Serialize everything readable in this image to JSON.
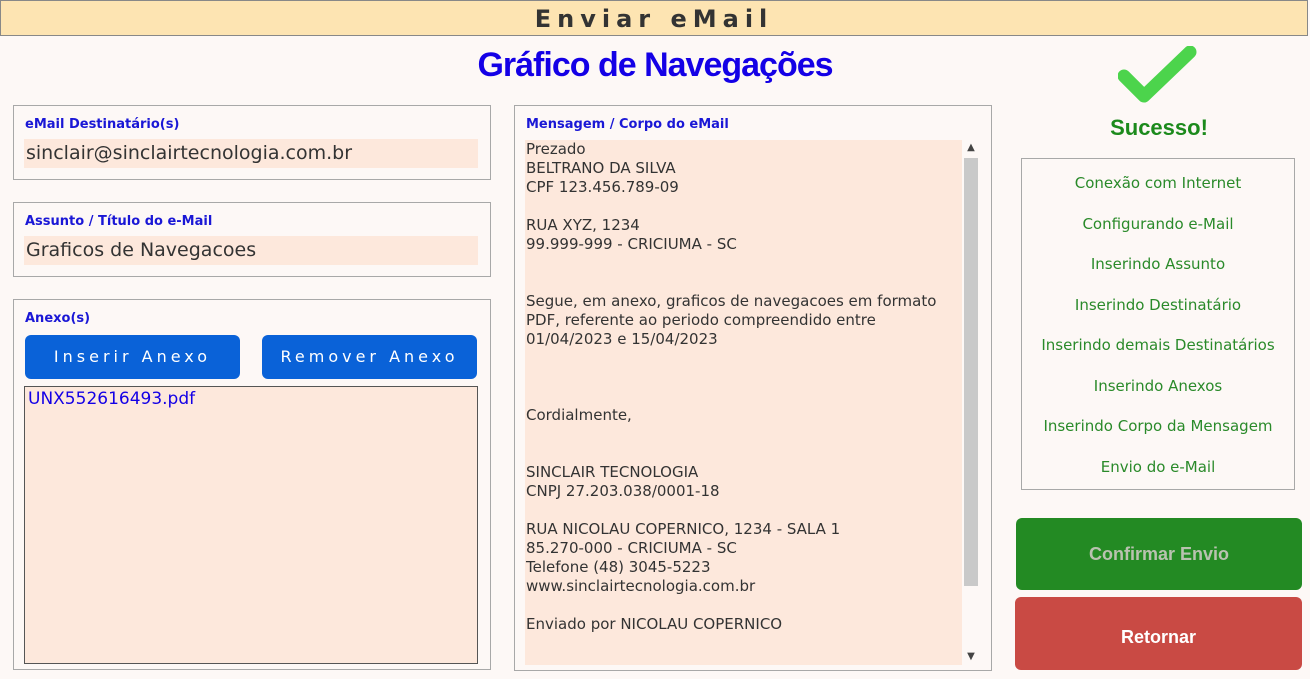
{
  "window": {
    "title": "Enviar eMail"
  },
  "header": {
    "title": "Gráfico de Navegações"
  },
  "recipients": {
    "label": "eMail Destinatário(s)",
    "value": "sinclair@sinclairtecnologia.com.br"
  },
  "subject": {
    "label": "Assunto / Título do e-Mail",
    "value": "Graficos de Navegacoes"
  },
  "attachments": {
    "label": "Anexo(s)",
    "add_label": "Inserir Anexo",
    "remove_label": "Remover Anexo",
    "files": [
      "UNX552616493.pdf"
    ]
  },
  "message": {
    "label": "Mensagem / Corpo do eMail",
    "body": "Prezado\nBELTRANO DA SILVA\nCPF 123.456.789-09\n\nRUA XYZ, 1234\n99.999-999 - CRICIUMA - SC\n\n\nSegue, em anexo, graficos de navegacoes em formato\nPDF, referente ao periodo compreendido entre\n01/04/2023 e 15/04/2023\n\n\n\nCordialmente,\n\n\nSINCLAIR TECNOLOGIA\nCNPJ 27.203.038/0001-18\n\nRUA NICOLAU COPERNICO, 1234 - SALA 1\n85.270-000 - CRICIUMA - SC\nTelefone (48) 3045-5223\nwww.sinclairtecnologia.com.br\n\nEnviado por NICOLAU COPERNICO"
  },
  "status": {
    "text": "Sucesso!",
    "icon": "check-icon",
    "color": "#4cd44c",
    "steps": [
      "Conexão com Internet",
      "Configurando e-Mail",
      "Inserindo Assunto",
      "Inserindo Destinatário",
      "Inserindo demais Destinatários",
      "Inserindo Anexos",
      "Inserindo Corpo da Mensagem",
      "Envio do e-Mail"
    ]
  },
  "actions": {
    "confirm_label": "Confirmar Envio",
    "return_label": "Retornar"
  },
  "colors": {
    "accent_blue": "#0a62d8",
    "confirm_green": "#238a23",
    "return_red": "#c94a44",
    "title_bar": "#fde4b2",
    "field_bg": "#fde8dc"
  }
}
